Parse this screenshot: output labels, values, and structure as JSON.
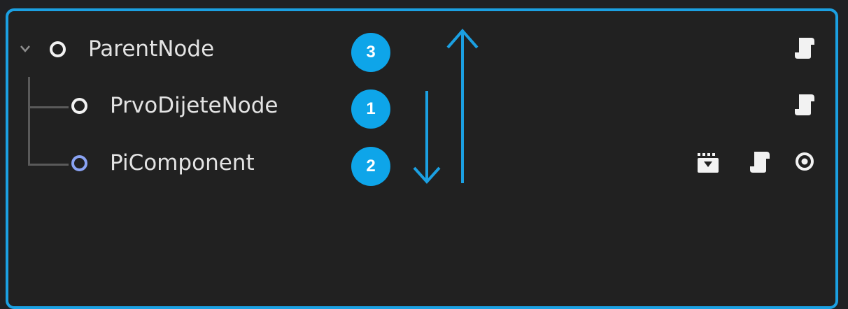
{
  "scene_tree": {
    "nodes": [
      {
        "label": "ParentNode",
        "badge": "3",
        "expanded": true
      },
      {
        "label": "PrvoDijeteNode",
        "badge": "1"
      },
      {
        "label": "PiComponent",
        "badge": "2"
      }
    ]
  },
  "colors": {
    "panel_border": "#1ba0e2",
    "badge": "#0ea5e9",
    "arrow": "#1ba0e2",
    "component_circle": "#8aa3f3"
  },
  "icons": {
    "node": "circle-outline-icon",
    "expand": "chevron-down-icon",
    "script": "script-scroll-icon",
    "scene": "clapperboard-icon",
    "visibility": "eye-icon",
    "order_down": "arrow-down-icon",
    "order_up": "arrow-up-icon"
  }
}
